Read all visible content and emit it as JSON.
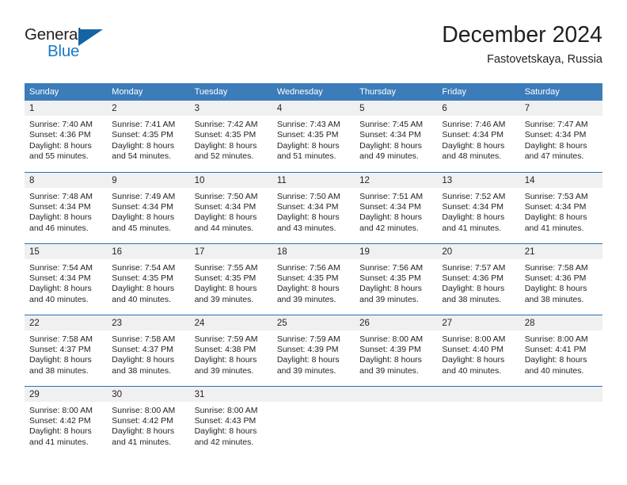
{
  "logo": {
    "word_one": "General",
    "word_two": "Blue",
    "triangle_icon": "blue-triangle-icon",
    "color_dark": "#231f20",
    "color_blue": "#1b7ac4",
    "color_triangle": "#1464a5"
  },
  "header": {
    "title": "December 2024",
    "subtitle": "Fastovetskaya, Russia"
  },
  "colors": {
    "header_blue": "#3b7cb9",
    "row_separator_blue": "#2c6fb5",
    "daynum_band_gray": "#f0f0f0",
    "text": "#231f20"
  },
  "calendar": {
    "weekdays": [
      "Sunday",
      "Monday",
      "Tuesday",
      "Wednesday",
      "Thursday",
      "Friday",
      "Saturday"
    ],
    "weeks": [
      [
        {
          "day": "1",
          "sunrise": "Sunrise: 7:40 AM",
          "sunset": "Sunset: 4:36 PM",
          "daylight_line1": "Daylight: 8 hours",
          "daylight_line2": "and 55 minutes."
        },
        {
          "day": "2",
          "sunrise": "Sunrise: 7:41 AM",
          "sunset": "Sunset: 4:35 PM",
          "daylight_line1": "Daylight: 8 hours",
          "daylight_line2": "and 54 minutes."
        },
        {
          "day": "3",
          "sunrise": "Sunrise: 7:42 AM",
          "sunset": "Sunset: 4:35 PM",
          "daylight_line1": "Daylight: 8 hours",
          "daylight_line2": "and 52 minutes."
        },
        {
          "day": "4",
          "sunrise": "Sunrise: 7:43 AM",
          "sunset": "Sunset: 4:35 PM",
          "daylight_line1": "Daylight: 8 hours",
          "daylight_line2": "and 51 minutes."
        },
        {
          "day": "5",
          "sunrise": "Sunrise: 7:45 AM",
          "sunset": "Sunset: 4:34 PM",
          "daylight_line1": "Daylight: 8 hours",
          "daylight_line2": "and 49 minutes."
        },
        {
          "day": "6",
          "sunrise": "Sunrise: 7:46 AM",
          "sunset": "Sunset: 4:34 PM",
          "daylight_line1": "Daylight: 8 hours",
          "daylight_line2": "and 48 minutes."
        },
        {
          "day": "7",
          "sunrise": "Sunrise: 7:47 AM",
          "sunset": "Sunset: 4:34 PM",
          "daylight_line1": "Daylight: 8 hours",
          "daylight_line2": "and 47 minutes."
        }
      ],
      [
        {
          "day": "8",
          "sunrise": "Sunrise: 7:48 AM",
          "sunset": "Sunset: 4:34 PM",
          "daylight_line1": "Daylight: 8 hours",
          "daylight_line2": "and 46 minutes."
        },
        {
          "day": "9",
          "sunrise": "Sunrise: 7:49 AM",
          "sunset": "Sunset: 4:34 PM",
          "daylight_line1": "Daylight: 8 hours",
          "daylight_line2": "and 45 minutes."
        },
        {
          "day": "10",
          "sunrise": "Sunrise: 7:50 AM",
          "sunset": "Sunset: 4:34 PM",
          "daylight_line1": "Daylight: 8 hours",
          "daylight_line2": "and 44 minutes."
        },
        {
          "day": "11",
          "sunrise": "Sunrise: 7:50 AM",
          "sunset": "Sunset: 4:34 PM",
          "daylight_line1": "Daylight: 8 hours",
          "daylight_line2": "and 43 minutes."
        },
        {
          "day": "12",
          "sunrise": "Sunrise: 7:51 AM",
          "sunset": "Sunset: 4:34 PM",
          "daylight_line1": "Daylight: 8 hours",
          "daylight_line2": "and 42 minutes."
        },
        {
          "day": "13",
          "sunrise": "Sunrise: 7:52 AM",
          "sunset": "Sunset: 4:34 PM",
          "daylight_line1": "Daylight: 8 hours",
          "daylight_line2": "and 41 minutes."
        },
        {
          "day": "14",
          "sunrise": "Sunrise: 7:53 AM",
          "sunset": "Sunset: 4:34 PM",
          "daylight_line1": "Daylight: 8 hours",
          "daylight_line2": "and 41 minutes."
        }
      ],
      [
        {
          "day": "15",
          "sunrise": "Sunrise: 7:54 AM",
          "sunset": "Sunset: 4:34 PM",
          "daylight_line1": "Daylight: 8 hours",
          "daylight_line2": "and 40 minutes."
        },
        {
          "day": "16",
          "sunrise": "Sunrise: 7:54 AM",
          "sunset": "Sunset: 4:35 PM",
          "daylight_line1": "Daylight: 8 hours",
          "daylight_line2": "and 40 minutes."
        },
        {
          "day": "17",
          "sunrise": "Sunrise: 7:55 AM",
          "sunset": "Sunset: 4:35 PM",
          "daylight_line1": "Daylight: 8 hours",
          "daylight_line2": "and 39 minutes."
        },
        {
          "day": "18",
          "sunrise": "Sunrise: 7:56 AM",
          "sunset": "Sunset: 4:35 PM",
          "daylight_line1": "Daylight: 8 hours",
          "daylight_line2": "and 39 minutes."
        },
        {
          "day": "19",
          "sunrise": "Sunrise: 7:56 AM",
          "sunset": "Sunset: 4:35 PM",
          "daylight_line1": "Daylight: 8 hours",
          "daylight_line2": "and 39 minutes."
        },
        {
          "day": "20",
          "sunrise": "Sunrise: 7:57 AM",
          "sunset": "Sunset: 4:36 PM",
          "daylight_line1": "Daylight: 8 hours",
          "daylight_line2": "and 38 minutes."
        },
        {
          "day": "21",
          "sunrise": "Sunrise: 7:58 AM",
          "sunset": "Sunset: 4:36 PM",
          "daylight_line1": "Daylight: 8 hours",
          "daylight_line2": "and 38 minutes."
        }
      ],
      [
        {
          "day": "22",
          "sunrise": "Sunrise: 7:58 AM",
          "sunset": "Sunset: 4:37 PM",
          "daylight_line1": "Daylight: 8 hours",
          "daylight_line2": "and 38 minutes."
        },
        {
          "day": "23",
          "sunrise": "Sunrise: 7:58 AM",
          "sunset": "Sunset: 4:37 PM",
          "daylight_line1": "Daylight: 8 hours",
          "daylight_line2": "and 38 minutes."
        },
        {
          "day": "24",
          "sunrise": "Sunrise: 7:59 AM",
          "sunset": "Sunset: 4:38 PM",
          "daylight_line1": "Daylight: 8 hours",
          "daylight_line2": "and 39 minutes."
        },
        {
          "day": "25",
          "sunrise": "Sunrise: 7:59 AM",
          "sunset": "Sunset: 4:39 PM",
          "daylight_line1": "Daylight: 8 hours",
          "daylight_line2": "and 39 minutes."
        },
        {
          "day": "26",
          "sunrise": "Sunrise: 8:00 AM",
          "sunset": "Sunset: 4:39 PM",
          "daylight_line1": "Daylight: 8 hours",
          "daylight_line2": "and 39 minutes."
        },
        {
          "day": "27",
          "sunrise": "Sunrise: 8:00 AM",
          "sunset": "Sunset: 4:40 PM",
          "daylight_line1": "Daylight: 8 hours",
          "daylight_line2": "and 40 minutes."
        },
        {
          "day": "28",
          "sunrise": "Sunrise: 8:00 AM",
          "sunset": "Sunset: 4:41 PM",
          "daylight_line1": "Daylight: 8 hours",
          "daylight_line2": "and 40 minutes."
        }
      ],
      [
        {
          "day": "29",
          "sunrise": "Sunrise: 8:00 AM",
          "sunset": "Sunset: 4:42 PM",
          "daylight_line1": "Daylight: 8 hours",
          "daylight_line2": "and 41 minutes."
        },
        {
          "day": "30",
          "sunrise": "Sunrise: 8:00 AM",
          "sunset": "Sunset: 4:42 PM",
          "daylight_line1": "Daylight: 8 hours",
          "daylight_line2": "and 41 minutes."
        },
        {
          "day": "31",
          "sunrise": "Sunrise: 8:00 AM",
          "sunset": "Sunset: 4:43 PM",
          "daylight_line1": "Daylight: 8 hours",
          "daylight_line2": "and 42 minutes."
        },
        {
          "day": "",
          "sunrise": "",
          "sunset": "",
          "daylight_line1": "",
          "daylight_line2": ""
        },
        {
          "day": "",
          "sunrise": "",
          "sunset": "",
          "daylight_line1": "",
          "daylight_line2": ""
        },
        {
          "day": "",
          "sunrise": "",
          "sunset": "",
          "daylight_line1": "",
          "daylight_line2": ""
        },
        {
          "day": "",
          "sunrise": "",
          "sunset": "",
          "daylight_line1": "",
          "daylight_line2": ""
        }
      ]
    ]
  }
}
